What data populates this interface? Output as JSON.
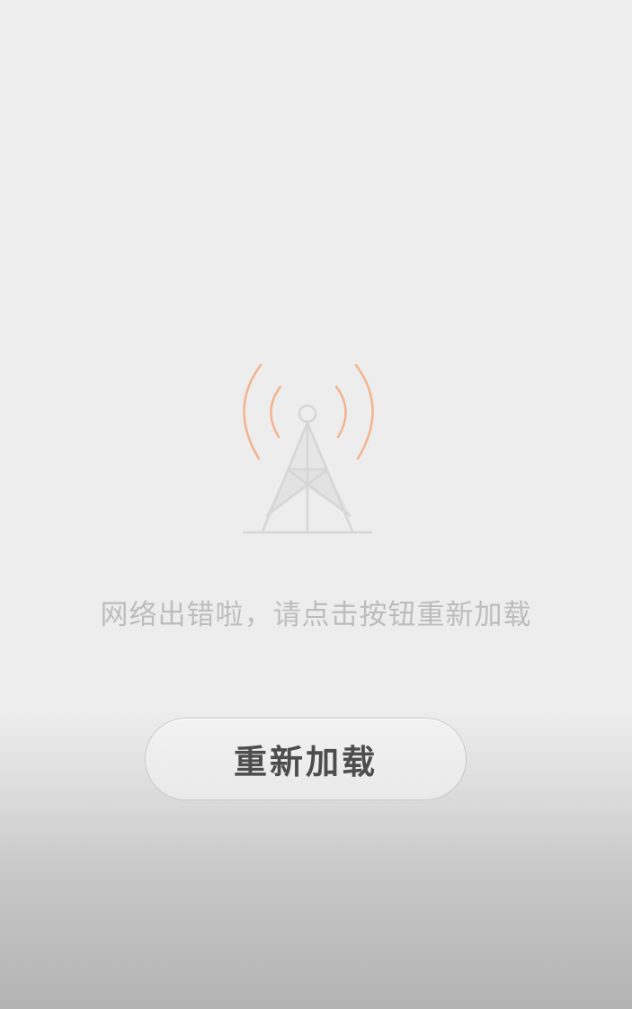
{
  "error": {
    "message": "网络出错啦，请点击按钮重新加载",
    "icon": "signal-tower-icon",
    "accent_color": "#f2b48f",
    "tower_color": "#d6d6d6"
  },
  "reload_button": {
    "label": "重新加载"
  }
}
